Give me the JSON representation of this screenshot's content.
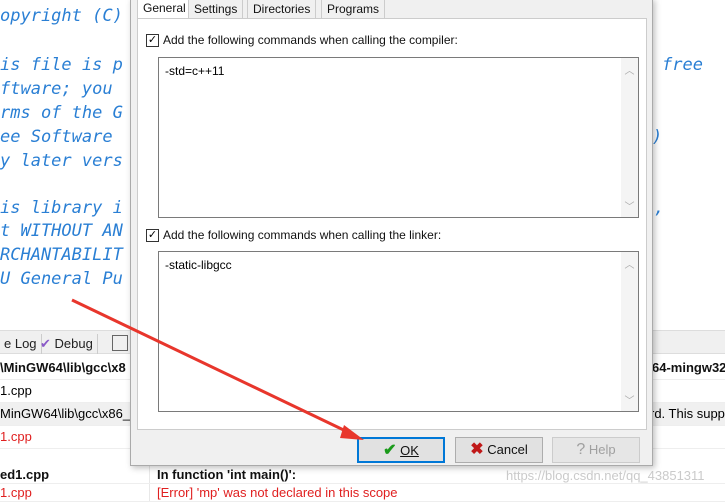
{
  "editor": {
    "lines": [
      "opyright (C)",
      "",
      "is file is p",
      "ftware; you",
      "rms of the G",
      "ee Software",
      "y later vers",
      "",
      "is library i",
      "t WITHOUT AN",
      "RCHANTABILIT",
      "U General Pu"
    ],
    "right_fragments": [
      "free",
      ")",
      ","
    ]
  },
  "bottom_panel": {
    "tabs": [
      "e Log",
      "Debug"
    ],
    "rows": [
      {
        "file": "\\MinGW64\\lib\\gcc\\x8",
        "message": "64-mingw32",
        "style": "bold"
      },
      {
        "file": "1.cpp",
        "message": "",
        "style": "normal"
      },
      {
        "file": "MinGW64\\lib\\gcc\\x86_",
        "message": "rd. This supp",
        "style": "normal"
      },
      {
        "file": "1.cpp",
        "message": "",
        "style": "red"
      },
      {
        "file": "ed1.cpp",
        "message": "In function 'int main()':",
        "style": "bold"
      },
      {
        "file": "1.cpp",
        "message": "[Error] 'mp' was not declared in this scope",
        "style": "red"
      }
    ]
  },
  "dialog": {
    "tabs": [
      "General",
      "Settings",
      "Directories",
      "Programs"
    ],
    "active_tab": "General",
    "compiler": {
      "checked": true,
      "label": "Add the following commands when calling the compiler:",
      "value": "-std=c++11"
    },
    "linker": {
      "checked": true,
      "label": "Add the following commands when calling the linker:",
      "value": "-static-libgcc"
    },
    "buttons": {
      "ok": "OK",
      "cancel": "Cancel",
      "help": "Help"
    }
  },
  "watermark": "https://blog.csdn.net/qq_43851311",
  "colors": {
    "annotation_arrow": "#e8362c",
    "editor_comment": "#2a7fd4",
    "error": "#e02020",
    "focus": "#0078d7"
  }
}
